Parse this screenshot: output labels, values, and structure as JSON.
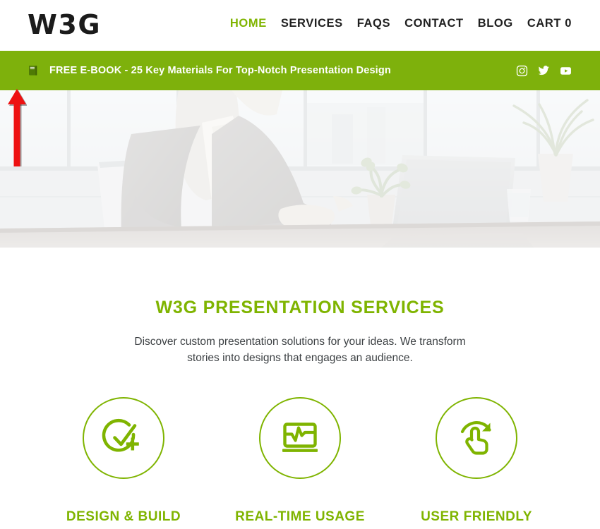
{
  "header": {
    "logo": "W3G",
    "nav": [
      {
        "label": "HOME",
        "active": true
      },
      {
        "label": "SERVICES",
        "active": false
      },
      {
        "label": "FAQS",
        "active": false
      },
      {
        "label": "CONTACT",
        "active": false
      },
      {
        "label": "BLOG",
        "active": false
      },
      {
        "label": "CART 0",
        "active": false
      }
    ]
  },
  "promo": {
    "icon": "book-icon",
    "text": "FREE E-BOOK - 25 Key Materials For Top-Notch Presentation Design",
    "background_color": "#7eb10c",
    "social": [
      {
        "name": "instagram-icon"
      },
      {
        "name": "twitter-icon"
      },
      {
        "name": "youtube-icon"
      }
    ]
  },
  "hero": {
    "description": "Businesswoman in grey blazer working on a laptop at an office desk with plants and a window view, faded light overlay"
  },
  "annotation": {
    "arrow": "red-up-arrow",
    "color": "#ee1111"
  },
  "services": {
    "title": "W3G PRESENTATION SERVICES",
    "description": "Discover custom presentation solutions for your ideas. We transform stories into designs that engages an audience.",
    "accent_color": "#7fb400",
    "items": [
      {
        "icon": "check-circle-plus-icon",
        "label": "DESIGN & BUILD"
      },
      {
        "icon": "laptop-chart-icon",
        "label": "REAL-TIME USAGE"
      },
      {
        "icon": "hand-gesture-rotate-icon",
        "label": "USER FRIENDLY"
      }
    ]
  }
}
